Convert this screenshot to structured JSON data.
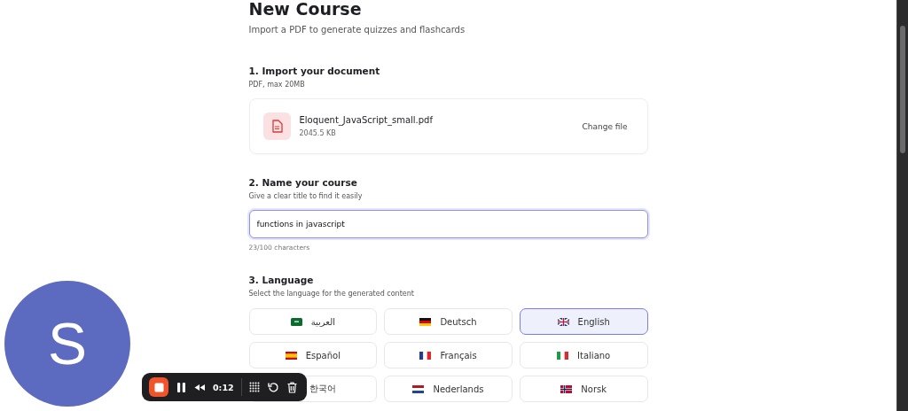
{
  "page": {
    "title": "New Course",
    "subtitle": "Import a PDF to generate quizzes and flashcards"
  },
  "import_section": {
    "heading": "1. Import your document",
    "hint": "PDF, max 20MB",
    "file": {
      "name": "Eloquent_JavaScript_small.pdf",
      "size": "2045.5 KB",
      "action": "Change file"
    }
  },
  "name_section": {
    "heading": "2. Name your course",
    "hint": "Give a clear title to find it easily",
    "input": {
      "value": "functions in javascript",
      "focused": true
    },
    "counter": "23/100 characters"
  },
  "language_section": {
    "heading": "3. Language",
    "hint": "Select the language for the generated content",
    "options": [
      {
        "label": "العربية",
        "kind": "sa",
        "selected": false
      },
      {
        "label": "Deutsch",
        "kind": "de",
        "selected": false
      },
      {
        "label": "English",
        "kind": "gb",
        "selected": true
      },
      {
        "label": "Español",
        "kind": "es",
        "selected": false
      },
      {
        "label": "Français",
        "kind": "fr",
        "selected": false
      },
      {
        "label": "Italiano",
        "kind": "it",
        "selected": false
      },
      {
        "label": "한국어",
        "selected": false
      },
      {
        "label": "Nederlands",
        "kind": "nl",
        "selected": false
      },
      {
        "label": "Norsk",
        "kind": "no",
        "selected": false
      }
    ]
  },
  "avatar": {
    "initial": "S"
  },
  "recorder": {
    "time": "0:12"
  }
}
